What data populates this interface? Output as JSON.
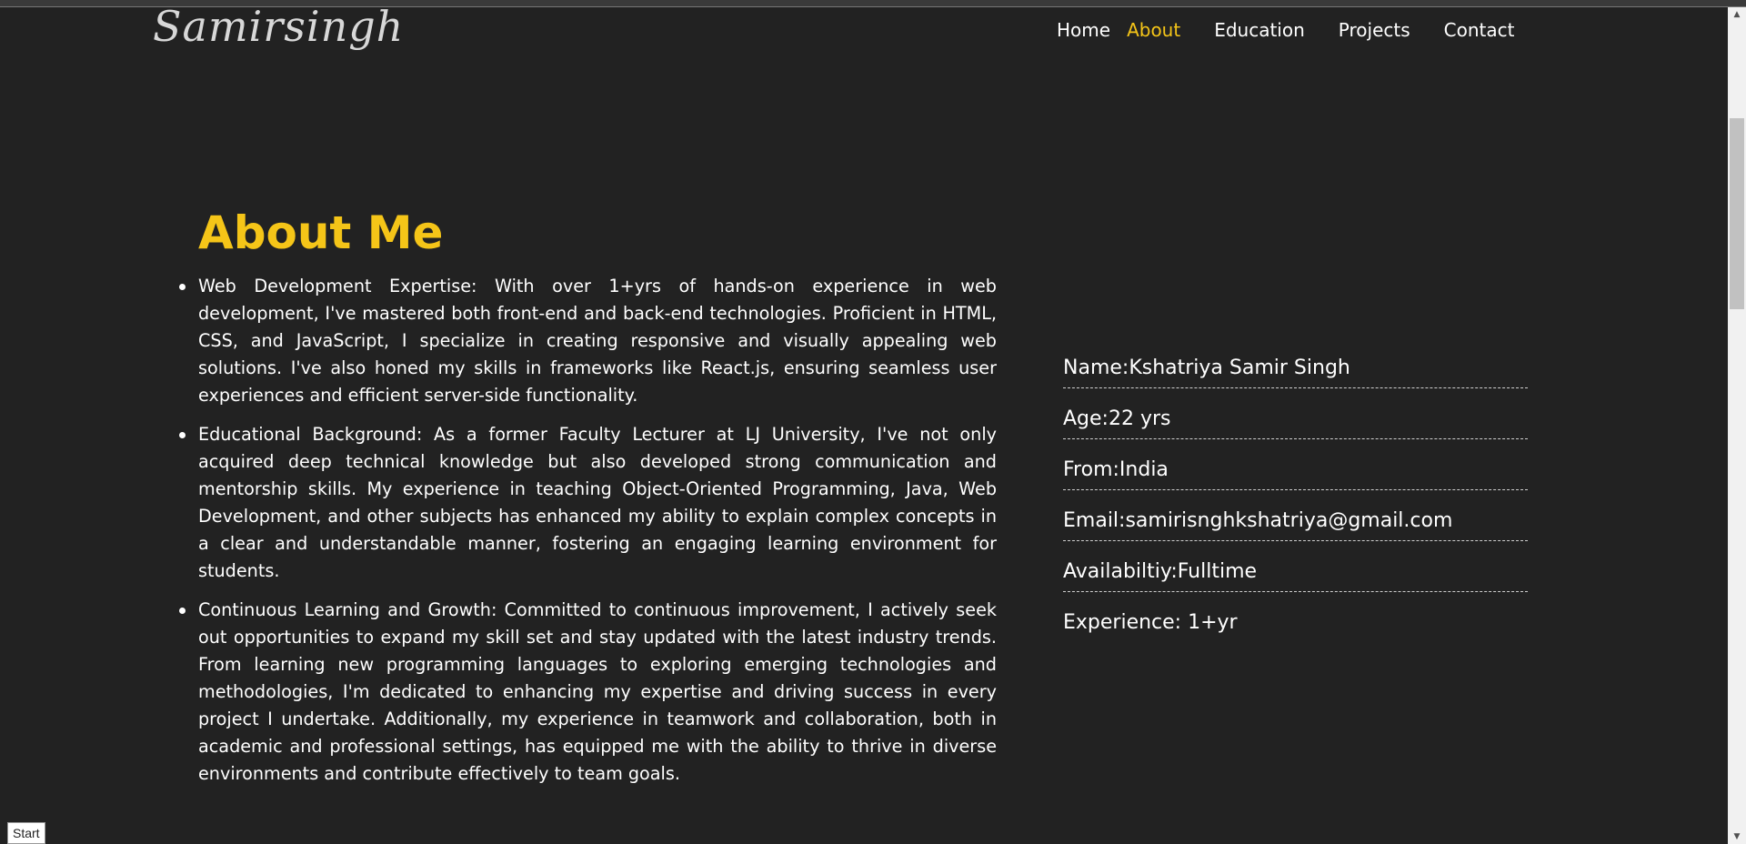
{
  "header": {
    "logo_text": "Samirsingh",
    "nav": [
      {
        "label": "Home",
        "active": false
      },
      {
        "label": "About",
        "active": true
      },
      {
        "label": "Education",
        "active": false
      },
      {
        "label": "Projects",
        "active": false
      },
      {
        "label": "Contact",
        "active": false
      }
    ]
  },
  "about": {
    "title": "About Me",
    "bullets": [
      "Web Development Expertise: With over 1+yrs of hands-on experience in web development, I've mastered both front-end and back-end technologies. Proficient in HTML, CSS, and JavaScript, I specialize in creating responsive and visually appealing web solutions. I've also honed my skills in frameworks like React.js, ensuring seamless user experiences and efficient server-side functionality.",
      "Educational Background: As a former Faculty Lecturer at LJ University, I've not only acquired deep technical knowledge but also developed strong communication and mentorship skills. My experience in teaching Object-Oriented Programming, Java, Web Development, and other subjects has enhanced my ability to explain complex concepts in a clear and understandable manner, fostering an engaging learning environment for students.",
      "Continuous Learning and Growth: Committed to continuous improvement, I actively seek out opportunities to expand my skill set and stay updated with the latest industry trends. From learning new programming languages to exploring emerging technologies and methodologies, I'm dedicated to enhancing my expertise and driving success in every project I undertake. Additionally, my experience in teamwork and collaboration, both in academic and professional settings, has equipped me with the ability to thrive in diverse environments and contribute effectively to team goals."
    ],
    "info": [
      "Name:Kshatriya Samir Singh",
      "Age:22 yrs",
      "From:India",
      "Email:samirisnghkshatriya@gmail.com",
      "Availabiltiy:Fulltime",
      "Experience: 1+yr"
    ]
  },
  "footer": {
    "start_label": "Start"
  },
  "colors": {
    "background": "#222222",
    "accent": "#f5c518",
    "text": "#ffffff"
  }
}
